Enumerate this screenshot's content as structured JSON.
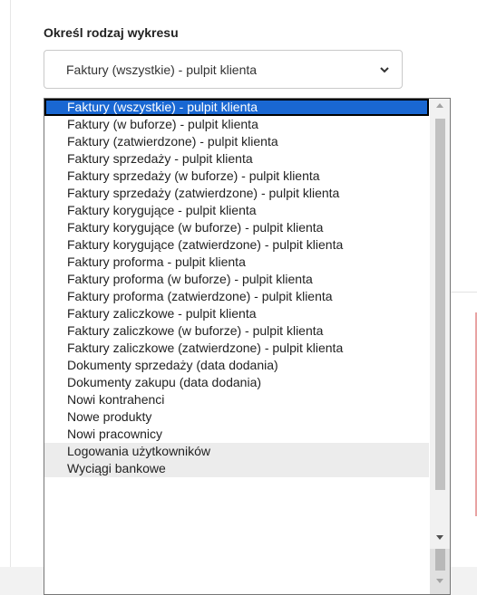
{
  "form": {
    "label": "Określ rodzaj wykresu",
    "selected_value": "Faktury (wszystkie) - pulpit klienta",
    "chevron_icon": "chevron-down-icon"
  },
  "dropdown": {
    "options": [
      "Faktury (wszystkie) - pulpit klienta",
      "Faktury (w buforze) - pulpit klienta",
      "Faktury (zatwierdzone) - pulpit klienta",
      "Faktury sprzedaży - pulpit klienta",
      "Faktury sprzedaży (w buforze) - pulpit klienta",
      "Faktury sprzedaży (zatwierdzone) - pulpit klienta",
      "Faktury korygujące - pulpit klienta",
      "Faktury korygujące (w buforze) - pulpit klienta",
      "Faktury korygujące (zatwierdzone) - pulpit klienta",
      "Faktury proforma - pulpit klienta",
      "Faktury proforma (w buforze) - pulpit klienta",
      "Faktury proforma (zatwierdzone) - pulpit klienta",
      "Faktury zaliczkowe - pulpit klienta",
      "Faktury zaliczkowe (w buforze) - pulpit klienta",
      "Faktury zaliczkowe (zatwierdzone) - pulpit klienta",
      "Dokumenty sprzedaży (data dodania)",
      "Dokumenty zakupu (data dodania)",
      "Nowi kontrahenci",
      "Nowe produkty",
      "Nowi pracownicy",
      "Logowania użytkowników",
      "Wyciągi bankowe"
    ],
    "selected_index": 0,
    "selected_color": "#1967d2"
  }
}
